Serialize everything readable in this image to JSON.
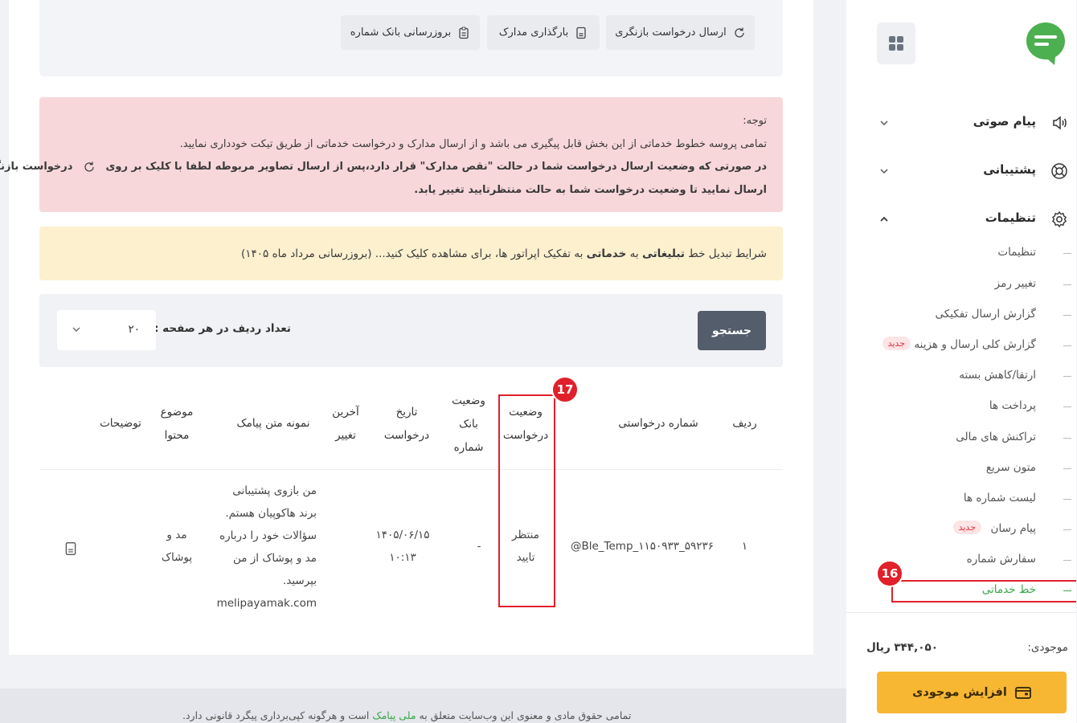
{
  "header": {
    "actions": [
      {
        "label": "ارسال درخواست بازنگری",
        "icon": "refresh-icon"
      },
      {
        "label": "بارگذاری مدارک",
        "icon": "document-icon"
      },
      {
        "label": "بروزرسانی بانک شماره",
        "icon": "clipboard-icon"
      }
    ]
  },
  "notice": {
    "title": "توجه:",
    "line1": "تمامی پروسه خطوط خدماتی از این بخش قابل پیگیری می باشد و از ارسال مدارک و درخواست خدماتی از طریق تیکت خودداری نمایید.",
    "line2a": "در صورتی که وضعیت ارسال درخواست شما در حالت \"نقص مدارک\" قرار دارد،پس از ارسال تصاویر مربوطه لطفا با کلیک بر روی",
    "line2b": "درخواست بازنگری را",
    "line3": "ارسال نمایید تا وضعیت درخواست شما به حالت منتظرتایید تغییر یابد."
  },
  "conditions": {
    "prefix": "شرایط تبدیل خط",
    "strong1": "تبلیغاتی",
    "mid1": "به",
    "strong2": "خدماتی",
    "suffix": "به تفکیک اپراتور ها، برای مشاهده کلیک کنید... (بروزرسانی مرداد ماه ۱۴۰۵)"
  },
  "search": {
    "button": "جستجو",
    "rows_label": "تعداد ردیف در هر صفحه :",
    "rows_value": "۲۰"
  },
  "table": {
    "headers": {
      "row": "ردیف",
      "request_no": "شماره درخواستی",
      "status_1": "وضعیت",
      "status_2": "درخواست",
      "bank_1": "وضعیت",
      "bank_2": "بانک",
      "bank_3": "شماره",
      "date_1": "تاریخ",
      "date_2": "درخواست",
      "last_1": "آخرین",
      "last_2": "تغییر",
      "sms": "نمونه متن پیامک",
      "subject_1": "موضوع",
      "subject_2": "محتوا",
      "notes": "توضیحات"
    },
    "row1": {
      "row": "۱",
      "request_no": "Ble_Temp_۱۱۵۰۹۳۳_۵۹۲۳۶@",
      "status_1": "منتظر",
      "status_2": "تایید",
      "bank": "-",
      "date_1": "۱۴۰۵/۰۶/۱۵",
      "date_2": "۱۰:۱۳",
      "sms_1": "من بازوی پشتیبانی",
      "sms_2": "برند هاکوپیان هستم.",
      "sms_3": "سؤالات خود را درباره",
      "sms_4": "مد و پوشاک از من",
      "sms_5": "بپرسید.",
      "sms_6": "melipayamak.com",
      "subject_1": "مد و",
      "subject_2": "پوشاک"
    }
  },
  "sidebar": {
    "main": [
      {
        "label": "پیام صوتی",
        "icon": "voice-icon"
      },
      {
        "label": "پشتیبانی",
        "icon": "support-icon"
      },
      {
        "label": "تنظیمات",
        "icon": "gear-icon"
      }
    ],
    "sub": [
      {
        "label": "تنظیمات"
      },
      {
        "label": "تغییر رمز"
      },
      {
        "label": "گزارش ارسال تفکیکی"
      },
      {
        "label": "گزارش کلی ارسال و هزینه",
        "badge": "جدید"
      },
      {
        "label": "ارتقا/کاهش بسته"
      },
      {
        "label": "پرداخت ها"
      },
      {
        "label": "تراکنش های مالی"
      },
      {
        "label": "متون سریع"
      },
      {
        "label": "لیست شماره ها"
      },
      {
        "label": "پیام رسان",
        "badge": "جدید"
      },
      {
        "label": "سفارش شماره"
      },
      {
        "label": "خط خدماتی"
      }
    ],
    "balance_label": "موجودی:",
    "balance_value": "۳۴۴,۰۵۰ ریال",
    "topup_button": "افزایش موجودی"
  },
  "markers": {
    "m16": "16",
    "m17": "17"
  },
  "footer": {
    "prefix": "تمامی حقوق مادی و معنوی این وب‌سایت متعلق به",
    "brand": "ملی پیامک",
    "suffix": "است و هرگونه کپی‌برداری پیگرد قانونی دارد."
  },
  "colors": {
    "accent": "#3aa64a",
    "danger": "#e0202a",
    "warning_btn": "#f7b733"
  }
}
